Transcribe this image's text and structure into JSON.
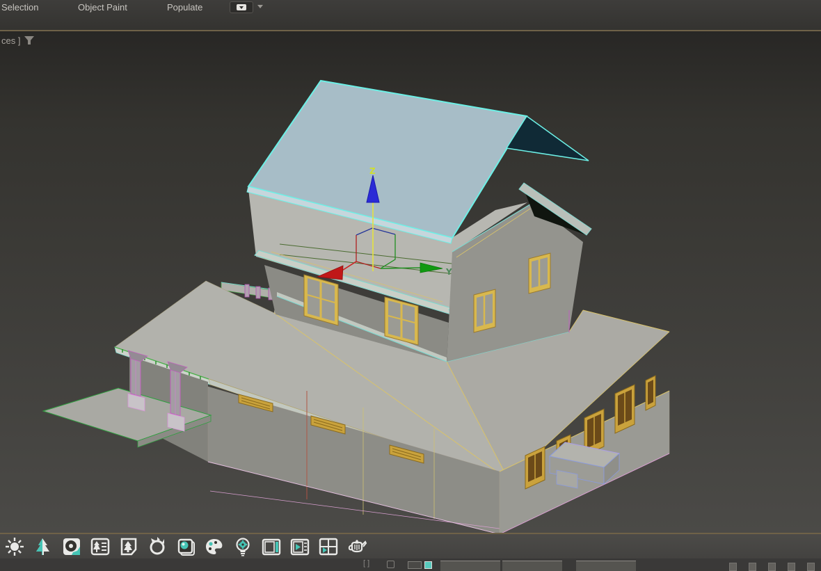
{
  "ribbon": {
    "tabs": [
      {
        "label": "Selection"
      },
      {
        "label": "Object Paint"
      },
      {
        "label": "Populate"
      }
    ]
  },
  "viewport": {
    "label_fragment": "ces ]",
    "gizmo": {
      "z_label": "Z",
      "y_label": "Y"
    }
  },
  "toolbar": {
    "icons": [
      {
        "name": "sun-light"
      },
      {
        "name": "tree-vegetation"
      },
      {
        "name": "render-setup-blade"
      },
      {
        "name": "tree-list-panel"
      },
      {
        "name": "tree-page-panel"
      },
      {
        "name": "fire-effect"
      },
      {
        "name": "rendered-frame-stack"
      },
      {
        "name": "material-palette"
      },
      {
        "name": "lightbulb-gear"
      },
      {
        "name": "viewport-monitor"
      },
      {
        "name": "play-preview-panel"
      },
      {
        "name": "layout-panes-arrow"
      },
      {
        "name": "teapot-render"
      }
    ]
  },
  "status": {
    "bracket_label": "[ ]"
  },
  "colors": {
    "selection_outline": "#6cf0e6",
    "selected_face": "#a7bdc7",
    "selected_back_face": "#102a36",
    "wire_yellow": "#d9c36a",
    "wire_teal": "#7fd8cf",
    "wire_green": "#2f9f3f",
    "wire_magenta": "#c45fc0",
    "axis_x": "#c01818",
    "axis_y": "#119911",
    "axis_z_active": "#e6e23e",
    "toolbar_accent": "#45c4b5"
  }
}
